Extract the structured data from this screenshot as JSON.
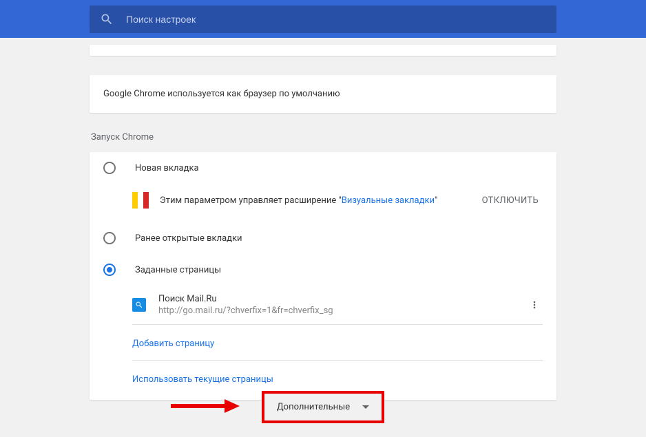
{
  "header": {
    "search_placeholder": "Поиск настроек"
  },
  "default_browser": {
    "message": "Google Chrome используется как браузер по умолчанию"
  },
  "startup": {
    "section_title": "Запуск Chrome",
    "options": {
      "new_tab": {
        "label": "Новая вкладка",
        "selected": false
      },
      "continue": {
        "label": "Ранее открытые вкладки",
        "selected": false
      },
      "specific": {
        "label": "Заданные страницы",
        "selected": true
      }
    },
    "extension_notice": {
      "prefix": "Этим параметром управляет расширение \"",
      "link": "Визуальные закладки",
      "suffix": "\"",
      "disable_label": "ОТКЛЮЧИТЬ"
    },
    "pages": [
      {
        "title": "Поиск Mail.Ru",
        "url": "http://go.mail.ru/?chverfix=1&fr=chverfix_sg"
      }
    ],
    "add_page_label": "Добавить страницу",
    "use_current_label": "Использовать текущие страницы"
  },
  "advanced_button_label": "Дополнительные",
  "colors": {
    "accent": "#1a73e8",
    "header": "#3367d6",
    "highlight": "#e80000"
  }
}
